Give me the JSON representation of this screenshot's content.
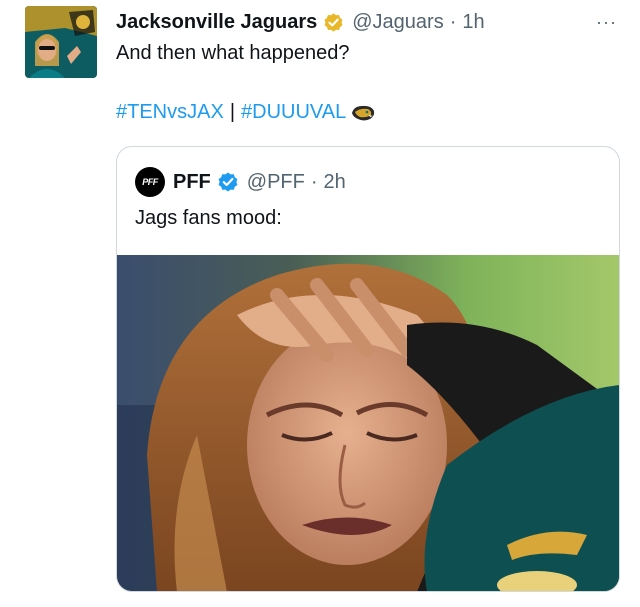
{
  "tweet": {
    "author_name": "Jacksonville Jaguars",
    "author_handle": "@Jaguars",
    "separator": "·",
    "time": "1h",
    "text": "And then what happened?",
    "hashtags": [
      "#TENvsJAX",
      "#DUUUVAL"
    ],
    "hashtag_divider": "|",
    "more_label": "···"
  },
  "quote": {
    "author_name": "PFF",
    "author_handle": "@PFF",
    "time": "2h",
    "text": "Jags fans mood:",
    "avatar_text": "PFF"
  },
  "icons": {
    "avatar": "jaguars-fan-avatar",
    "verified_gold": "verified-badge-gold-icon",
    "verified_blue": "verified-badge-blue-icon",
    "hashtag_emoji": "jaguar-emoji-icon",
    "more": "more-options-icon"
  },
  "colors": {
    "link": "#1d9bf0",
    "gold_badge": "#e8b829",
    "blue_badge": "#1d9bf0",
    "muted": "#536471"
  }
}
